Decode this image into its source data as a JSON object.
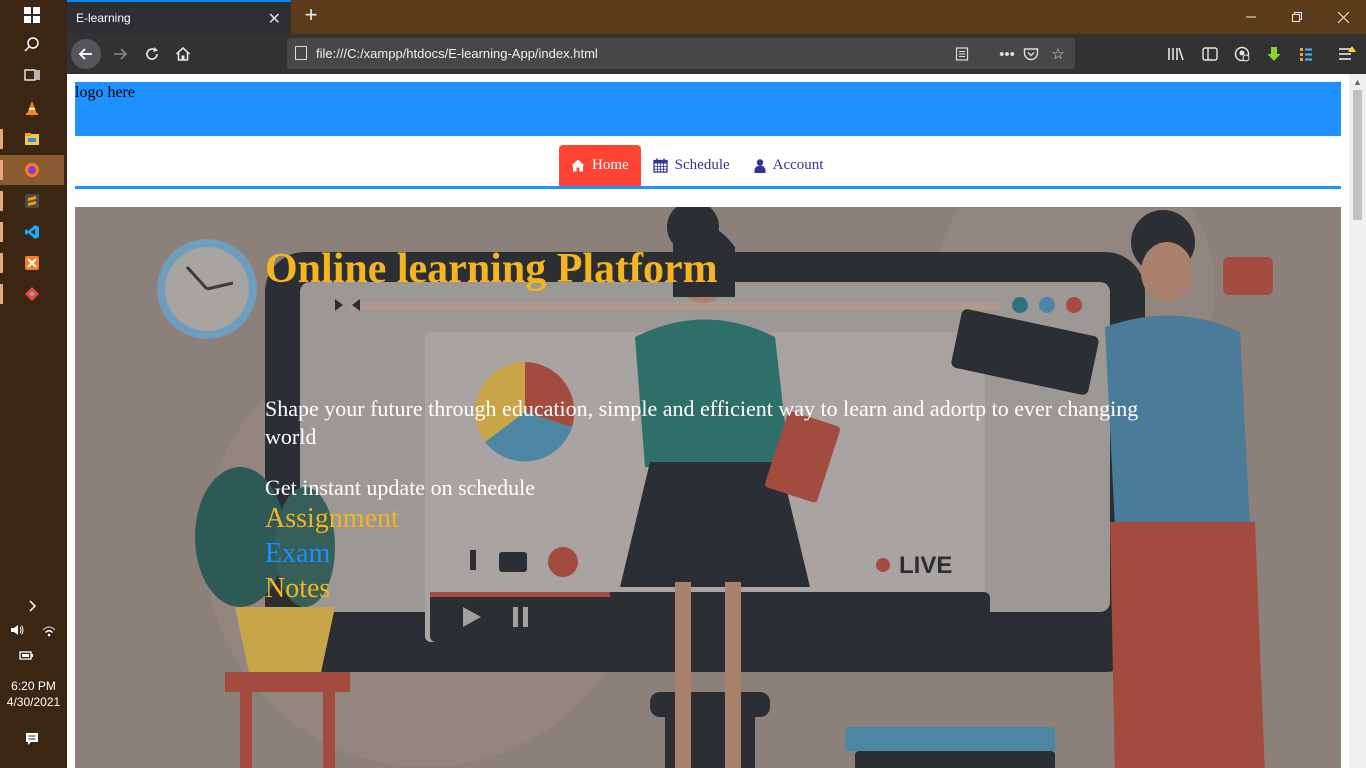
{
  "taskbar": {
    "time": "6:20 PM",
    "date": "4/30/2021"
  },
  "browser": {
    "tab_title": "E-learning",
    "url": "file:///C:/xampp/htdocs/E-learning-App/index.html",
    "accent": "#0a84ff"
  },
  "site": {
    "logo_text": "logo here",
    "header_color": "#1e90ff",
    "nav": [
      {
        "label": "Home",
        "icon": "home-icon",
        "active": true
      },
      {
        "label": "Schedule",
        "icon": "calendar-icon",
        "active": false
      },
      {
        "label": "Account",
        "icon": "user-icon",
        "active": false
      }
    ],
    "hero": {
      "title": "Online learning Platform",
      "subtitle": "Shape your future through education, simple and efficient way to learn and adortp to ever changing world",
      "update_text": "Get instant update on schedule",
      "links": [
        "Assignment",
        "Exam",
        "Notes"
      ]
    }
  }
}
